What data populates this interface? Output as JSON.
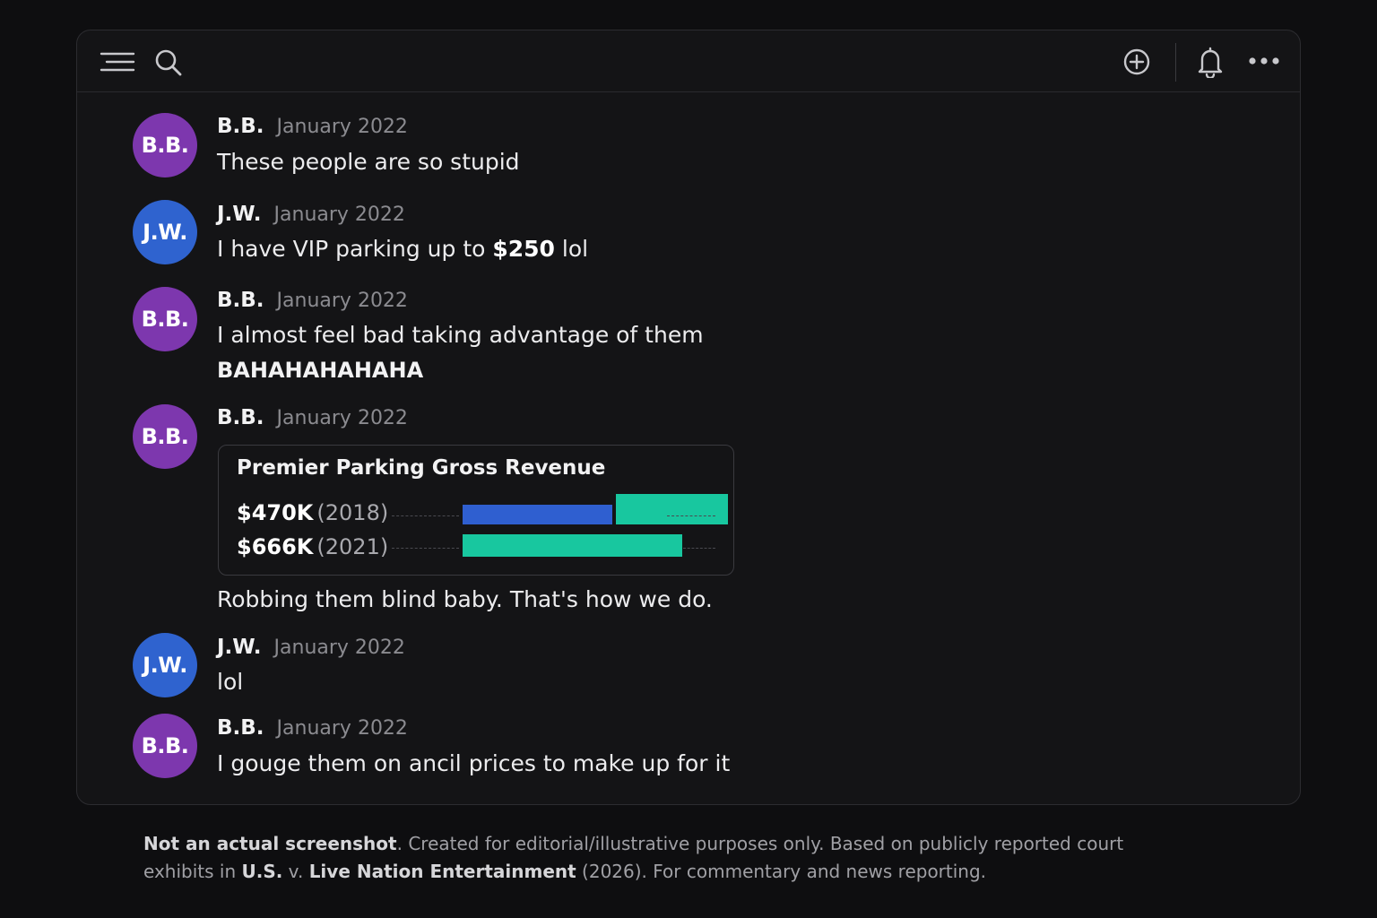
{
  "toolbar": {
    "left_icons": [
      "menu-icon",
      "search-icon"
    ],
    "right_icons": [
      "add-circle-icon",
      "bell-icon",
      "more-icon"
    ]
  },
  "messages": [
    {
      "initials": "B.B.",
      "author": "B.B.",
      "date": "January 2022",
      "text": "These people are so stupid"
    },
    {
      "initials": "J.W.",
      "author": "J.W.",
      "date": "January 2022",
      "text_before": "I have VIP parking up to ",
      "text_bold": "$250",
      "text_after": " lol"
    },
    {
      "initials": "B.B.",
      "author": "B.B.",
      "date": "January 2022",
      "text": "I almost feel bad taking advantage of them",
      "text2": "BAHAHAHAHAHA"
    },
    {
      "initials": "B.B.",
      "author": "B.B.",
      "date": "January 2022",
      "text": "Robbing them blind baby. That's how we do."
    },
    {
      "initials": "J.W.",
      "author": "J.W.",
      "date": "January 2022",
      "text": "lol"
    },
    {
      "initials": "B.B.",
      "author": "B.B.",
      "date": "January 2022",
      "text": "I gouge them on ancil prices to make up for it"
    }
  ],
  "revenue_card": {
    "title": "Premier Parking Gross Revenue",
    "rows": [
      {
        "amount": "$470K",
        "year": "(2018)"
      },
      {
        "amount": "$666K",
        "year": "(2021)"
      }
    ]
  },
  "chart_data": {
    "type": "bar",
    "title": "Premier Parking Gross Revenue",
    "categories": [
      "2018",
      "2021"
    ],
    "values": [
      470,
      666
    ],
    "unit": "$K"
  },
  "colors": {
    "avatar_bb": "#7d37ae",
    "avatar_jw": "#2f63cf",
    "bar_blue": "#2f5fd0",
    "bar_teal": "#18c79f"
  },
  "disclaimer": {
    "bold1": "Not an actual screenshot",
    "text1": ". Created for editorial/illustrative purposes only. Based on publicly reported court exhibits in ",
    "bold2": "U.S.",
    "text2": " v. ",
    "bold3": "Live Nation Entertainment",
    "text3": " (2026). For commentary and news reporting."
  }
}
